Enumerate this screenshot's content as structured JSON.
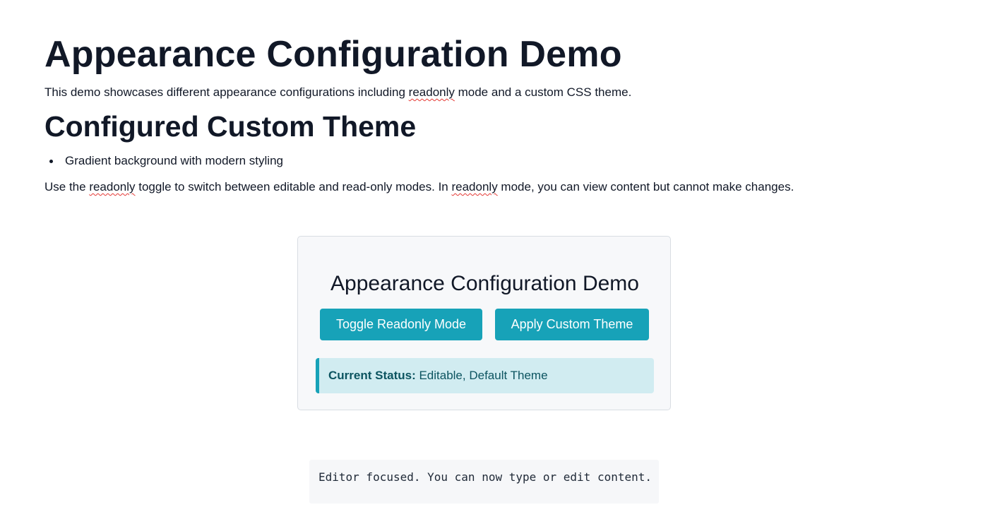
{
  "page": {
    "title": "Appearance Configuration Demo",
    "intro": {
      "before": "This demo showcases different appearance configurations including ",
      "flagged_word": "readonly",
      "after": " mode and a custom CSS theme."
    },
    "section_title": "Configured Custom Theme",
    "features": [
      "Gradient background with modern styling"
    ],
    "usage": {
      "part1": "Use the ",
      "flagged_word_1": "readonly",
      "part2": " toggle to switch between editable and read-only modes. In ",
      "flagged_word_2": "readonly",
      "part3": " mode, you can view content but cannot make changes."
    }
  },
  "demo": {
    "title": "Appearance Configuration Demo",
    "buttons": {
      "toggle_readonly": "Toggle Readonly Mode",
      "apply_theme": "Apply Custom Theme"
    },
    "status": {
      "label": "Current Status:",
      "value": " Editable, Default Theme"
    }
  },
  "console": {
    "message": "Editor focused. You can now type or edit content."
  },
  "colors": {
    "accent": "#17a2b8",
    "status_bg": "#d1ecf1",
    "status_text": "#0c5460",
    "spellcheck_underline": "#e53935"
  }
}
